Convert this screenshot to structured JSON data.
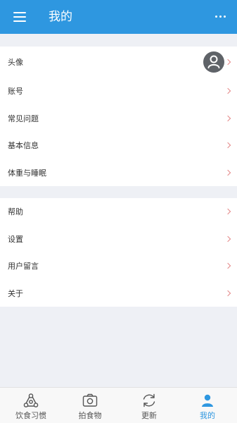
{
  "header": {
    "title": "我的",
    "menu_icon": "hamburger-menu-icon",
    "more_icon": "more-horizontal-icon",
    "color": "#2e97e0"
  },
  "profile_section": [
    {
      "label": "头像",
      "has_avatar": true
    },
    {
      "label": "账号"
    },
    {
      "label": "常见问题"
    },
    {
      "label": "基本信息"
    },
    {
      "label": "体重与睡眠"
    }
  ],
  "support_section": [
    {
      "label": "帮助"
    },
    {
      "label": "设置"
    },
    {
      "label": "用户留言"
    },
    {
      "label": "关于"
    }
  ],
  "tabbar": {
    "items": [
      {
        "label": "饮食习惯",
        "icon": "diet-habits-icon",
        "active": false
      },
      {
        "label": "拍食物",
        "icon": "camera-icon",
        "active": false
      },
      {
        "label": "更新",
        "icon": "refresh-icon",
        "active": false
      },
      {
        "label": "我的",
        "icon": "person-icon",
        "active": true
      }
    ],
    "active_color": "#2e97e0"
  },
  "chevron_color": "#e48a8a"
}
